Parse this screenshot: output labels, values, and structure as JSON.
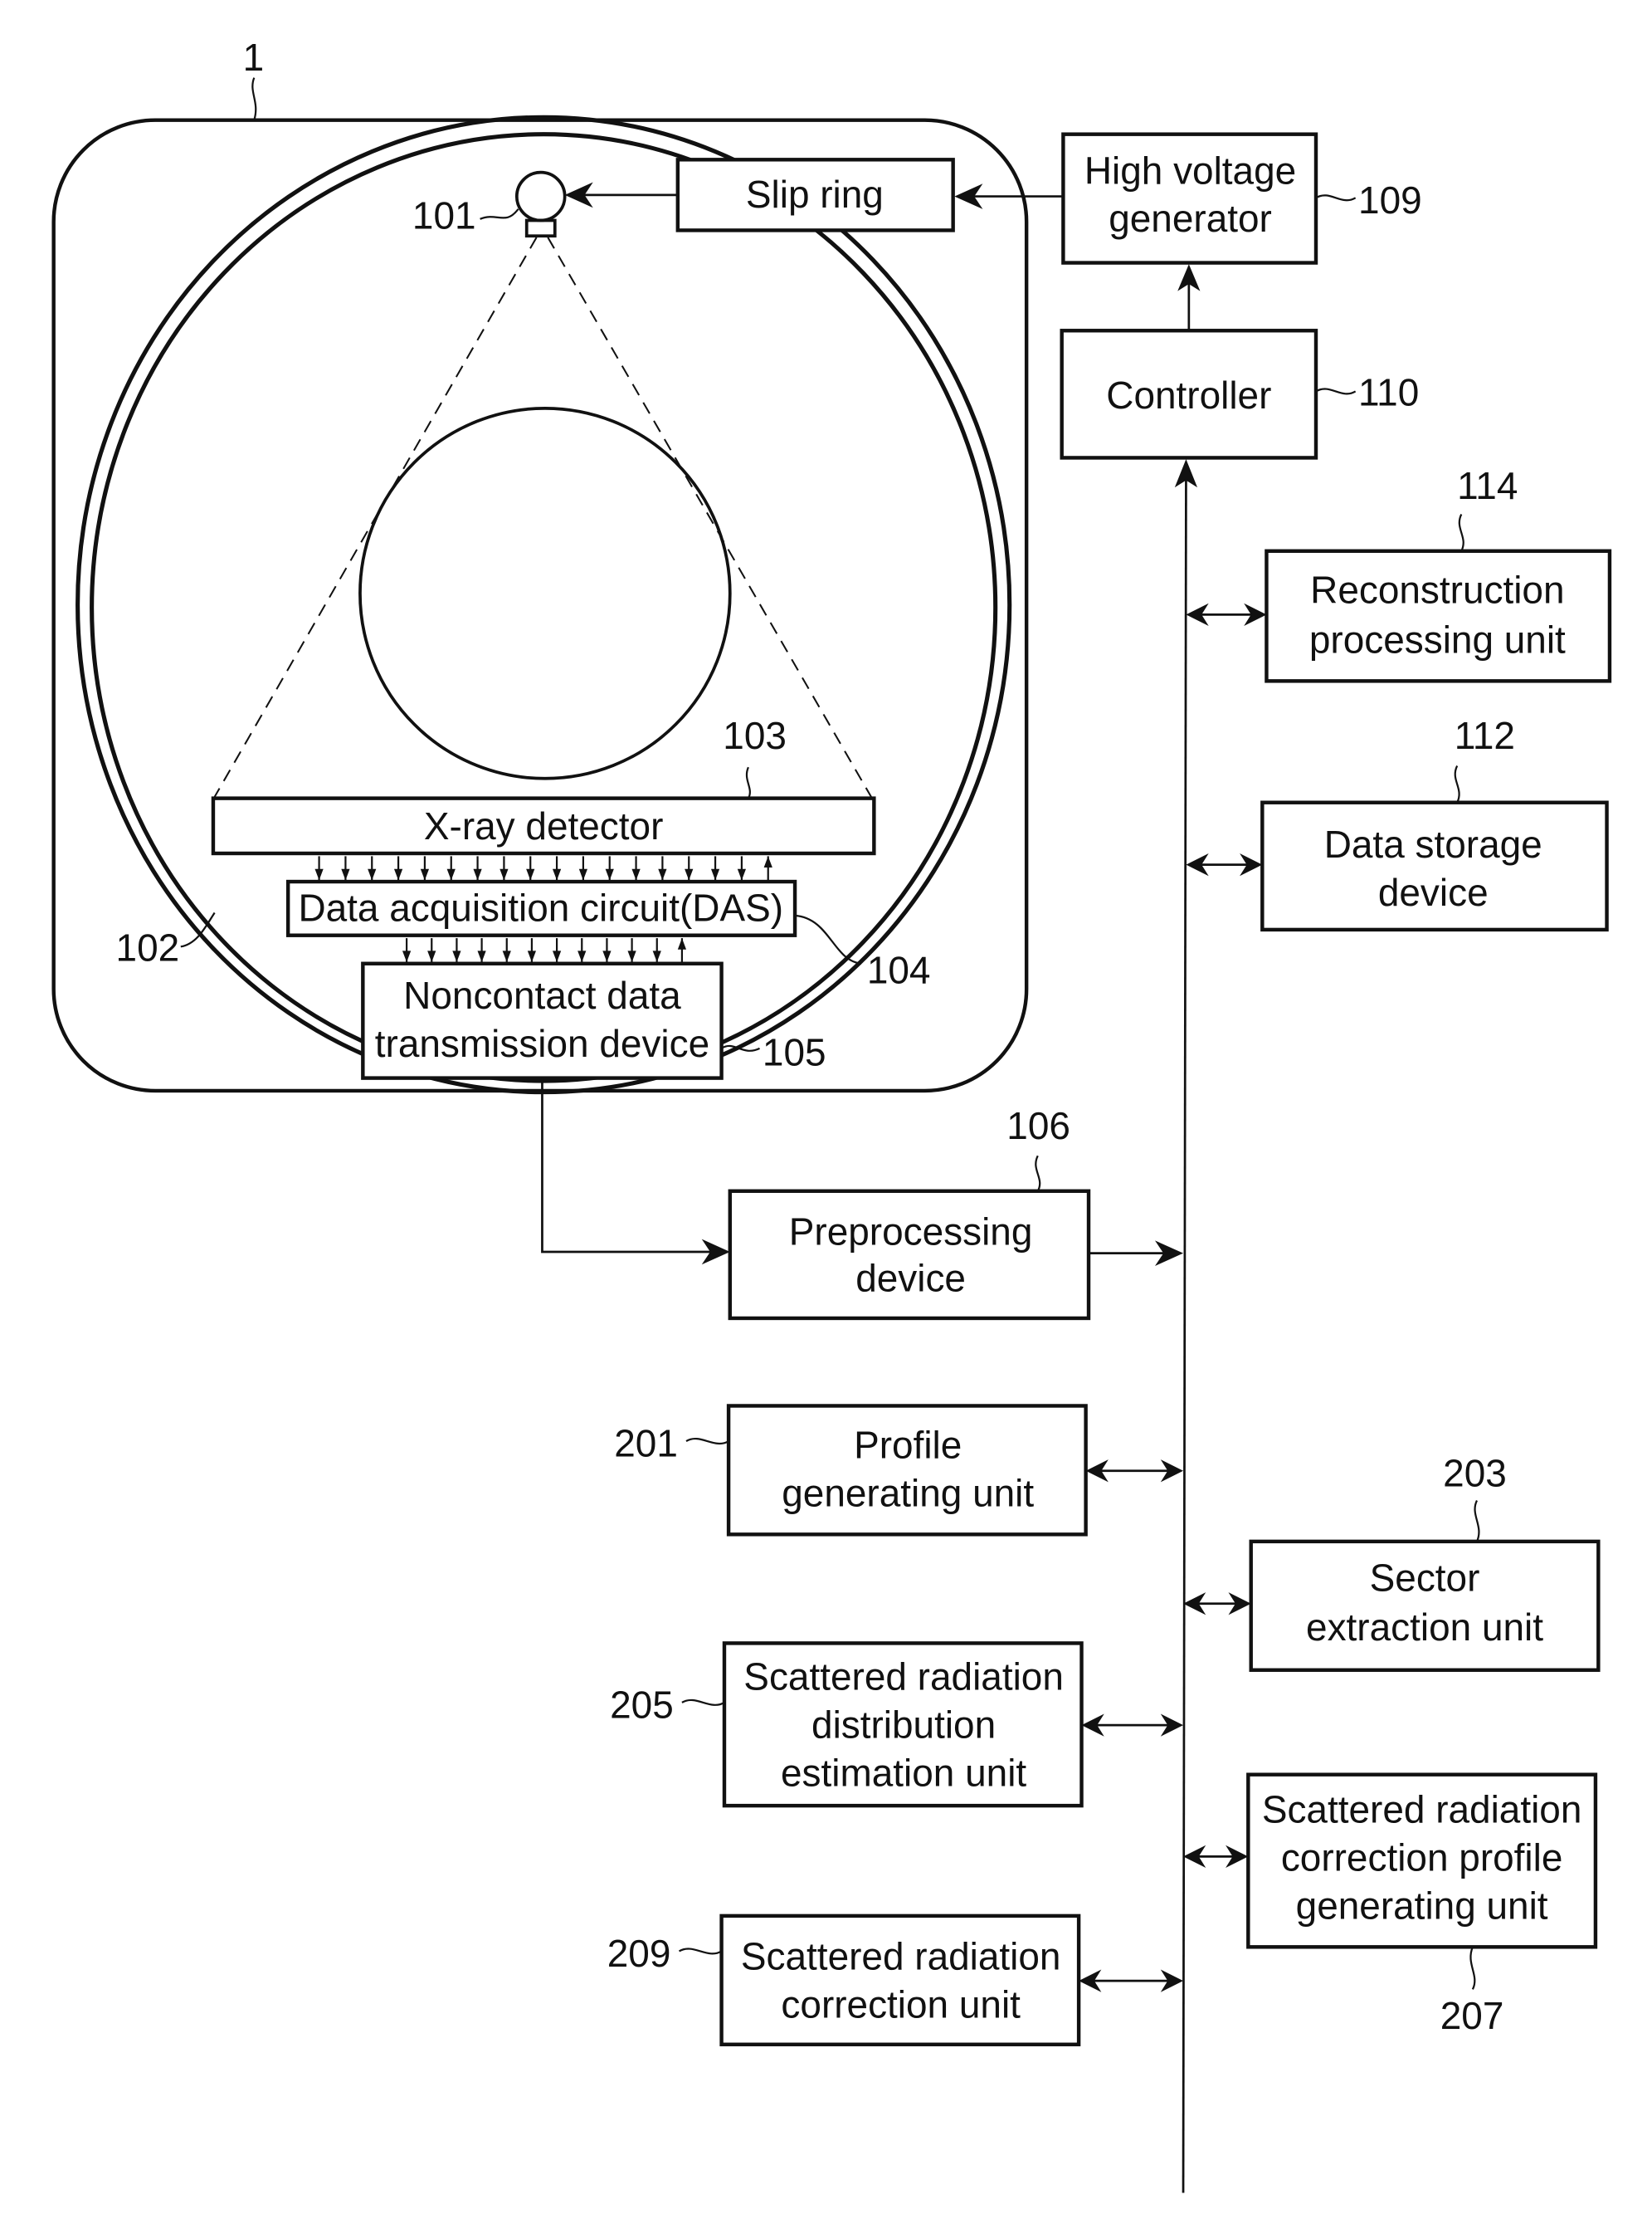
{
  "figure": {
    "reference_numerals": {
      "gantry": "1",
      "xray_tube": "101",
      "rotating_ring": "102",
      "xray_detector": "103",
      "das": "104",
      "noncontact": "105",
      "preprocessing": "106",
      "hv_generator": "109",
      "controller": "110",
      "data_storage": "112",
      "reconstruction": "114",
      "profile_generating": "201",
      "sector_extraction": "203",
      "scatter_distribution": "205",
      "scatter_correction_profile": "207",
      "scatter_correction": "209"
    },
    "blocks": {
      "slip_ring": [
        "Slip ring"
      ],
      "hv_generator": [
        "High voltage",
        "generator"
      ],
      "controller": [
        "Controller"
      ],
      "reconstruction": [
        "Reconstruction",
        "processing unit"
      ],
      "data_storage": [
        "Data storage",
        "device"
      ],
      "xray_detector": [
        "X-ray detector"
      ],
      "das": [
        "Data acquisition circuit(DAS)"
      ],
      "noncontact": [
        "Noncontact data",
        "transmission device"
      ],
      "preprocessing": [
        "Preprocessing",
        "device"
      ],
      "profile_generating": [
        "Profile",
        "generating unit"
      ],
      "sector_extraction": [
        "Sector",
        "extraction unit"
      ],
      "scatter_distribution": [
        "Scattered radiation",
        "distribution",
        "estimation unit"
      ],
      "scatter_correction_profile": [
        "Scattered radiation",
        "correction profile",
        "generating unit"
      ],
      "scatter_correction": [
        "Scattered radiation",
        "correction unit"
      ]
    },
    "detector_to_das_channels": {
      "down": 17,
      "up": 1
    },
    "das_to_transmission_channels": {
      "down": 11,
      "up": 1
    }
  }
}
